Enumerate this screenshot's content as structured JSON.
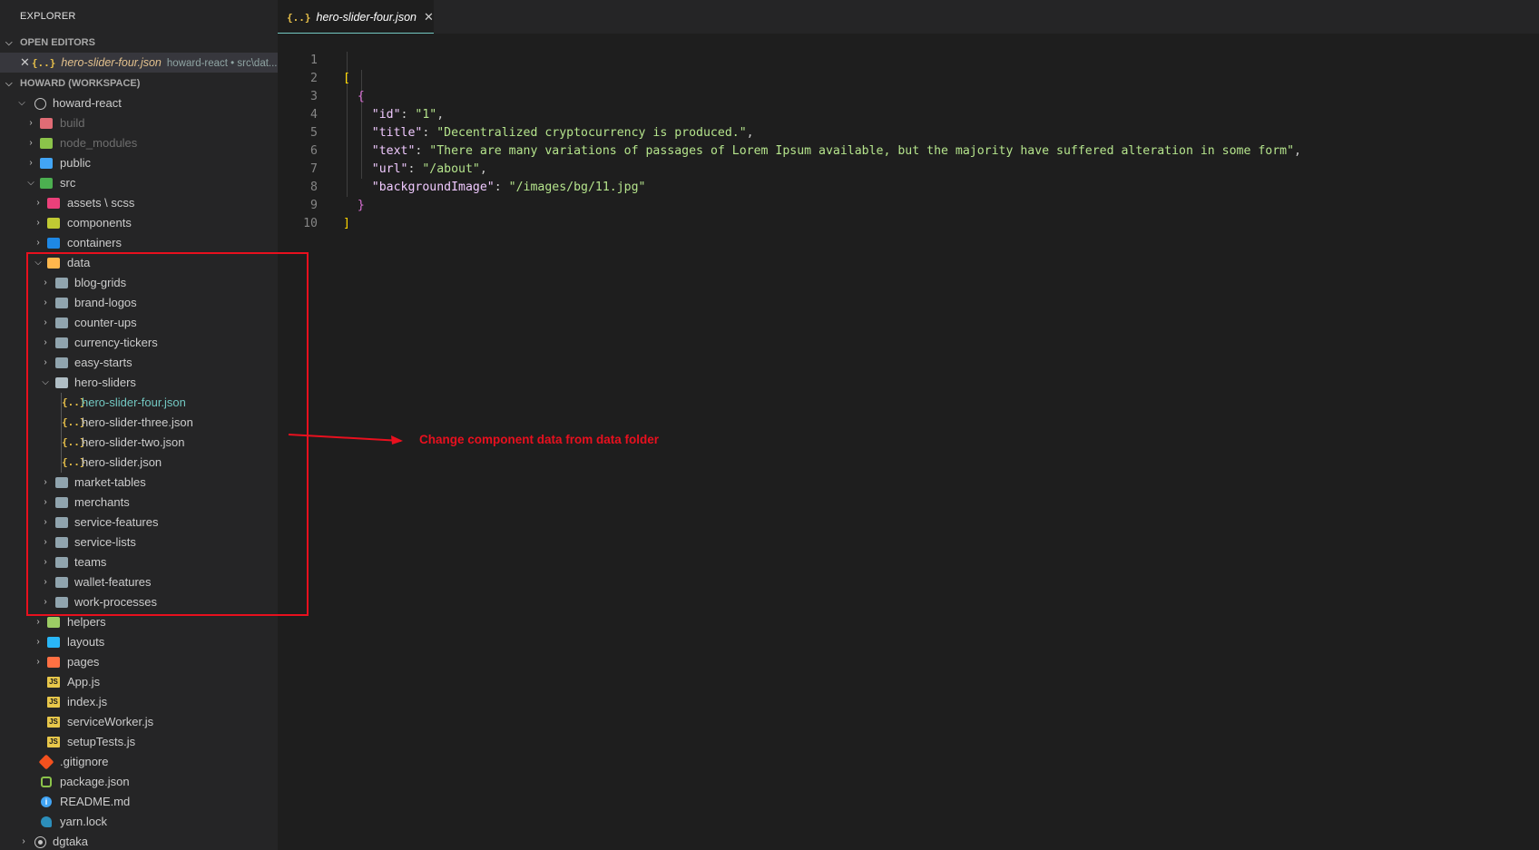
{
  "sidebar": {
    "title": "EXPLORER",
    "open_editors_header": "OPEN EDITORS",
    "open_editor": {
      "icon": "{..}",
      "name": "hero-slider-four.json",
      "desc": "howard-react • src\\dat..."
    },
    "workspace_header": "HOWARD (WORKSPACE)",
    "tree": {
      "root": "howard-react",
      "build": "build",
      "node_modules": "node_modules",
      "public": "public",
      "src": "src",
      "assets": "assets \\ scss",
      "components": "components",
      "containers": "containers",
      "data": "data",
      "data_children": {
        "blog_grids": "blog-grids",
        "brand_logos": "brand-logos",
        "counter_ups": "counter-ups",
        "currency_tickers": "currency-tickers",
        "easy_starts": "easy-starts",
        "hero_sliders": "hero-sliders",
        "market_tables": "market-tables",
        "merchants": "merchants",
        "service_features": "service-features",
        "service_lists": "service-lists",
        "teams": "teams",
        "wallet_features": "wallet-features",
        "work_processes": "work-processes"
      },
      "hero_files": {
        "four": "hero-slider-four.json",
        "three": "hero-slider-three.json",
        "two": "hero-slider-two.json",
        "one": "hero-slider.json"
      },
      "helpers": "helpers",
      "layouts": "layouts",
      "pages": "pages",
      "app_js": "App.js",
      "index_js": "index.js",
      "service_worker": "serviceWorker.js",
      "setup_tests": "setupTests.js",
      "gitignore": ".gitignore",
      "package_json": "package.json",
      "readme": "README.md",
      "yarn_lock": "yarn.lock",
      "dgtaka": "dgtaka"
    }
  },
  "tab": {
    "icon": "{..}",
    "name": "hero-slider-four.json",
    "close": "✕"
  },
  "editor": {
    "line_numbers": [
      "1",
      "2",
      "3",
      "4",
      "5",
      "6",
      "7",
      "8",
      "9",
      "10"
    ],
    "open_bracket": "[",
    "open_brace": "{",
    "id_key": "\"id\"",
    "id_val": "\"1\"",
    "title_key": "\"title\"",
    "title_val": "\"Decentralized cryptocurrency is produced.\"",
    "text_key": "\"text\"",
    "text_val": "\"There are many variations of passages of Lorem Ipsum available, but the majority have suffered alteration in some form\"",
    "url_key": "\"url\"",
    "url_val": "\"/about\"",
    "bg_key": "\"backgroundImage\"",
    "bg_val": "\"/images/bg/11.jpg\"",
    "close_brace": "}",
    "close_bracket": "]"
  },
  "annotation": {
    "text": "Change component data from data folder",
    "color": "#e8101e"
  },
  "colors": {
    "sidebar_bg": "#252526",
    "editor_bg": "#1e1e1e",
    "accent": "#73c8c2"
  }
}
